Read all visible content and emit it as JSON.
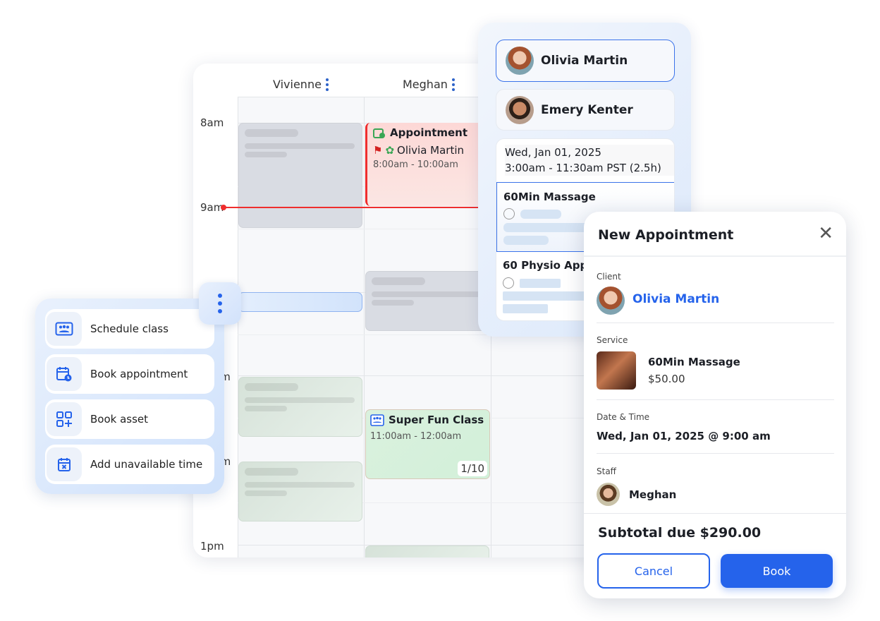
{
  "calendar": {
    "columns": [
      {
        "name": "Vivienne"
      },
      {
        "name": "Meghan"
      }
    ],
    "time_labels": [
      "8am",
      "9am",
      "11am",
      "12pm",
      "1pm"
    ],
    "appointment": {
      "title": "Appointment",
      "client": "Olivia Martin",
      "time": "8:00am - 10:00am",
      "color": "#ef2e2e"
    },
    "class_event": {
      "title": "Super Fun Class",
      "time": "11:00am - 12:00am",
      "capacity": "1/10"
    },
    "now_line_color": "#ef2e2e"
  },
  "client_panel": {
    "clients": [
      {
        "name": "Olivia Martin",
        "selected": true
      },
      {
        "name": "Emery Kenter",
        "selected": false
      }
    ],
    "date": "Wed, Jan 01, 2025",
    "time_range": "3:00am - 11:30am PST (2.5h)",
    "services": [
      {
        "name": "60Min Massage",
        "selected": true
      },
      {
        "name": "60 Physio Appo"
      }
    ]
  },
  "modal": {
    "title": "New Appointment",
    "client_label": "Client",
    "client_name": "Olivia Martin",
    "service_label": "Service",
    "service_name": "60Min Massage",
    "service_price": "$50.00",
    "datetime_label": "Date & Time",
    "datetime_value": "Wed, Jan 01, 2025 @ 9:00 am",
    "staff_label": "Staff",
    "staff_name": "Meghan",
    "subtotal": "Subtotal due $290.00",
    "cancel_label": "Cancel",
    "book_label": "Book",
    "accent": "#2563eb"
  },
  "menu": {
    "items": [
      {
        "label": "Schedule class",
        "icon": "class-icon"
      },
      {
        "label": "Book appointment",
        "icon": "calendar-clock-icon"
      },
      {
        "label": "Book asset",
        "icon": "grid-plus-icon"
      },
      {
        "label": "Add unavailable time",
        "icon": "calendar-x-icon"
      }
    ]
  }
}
